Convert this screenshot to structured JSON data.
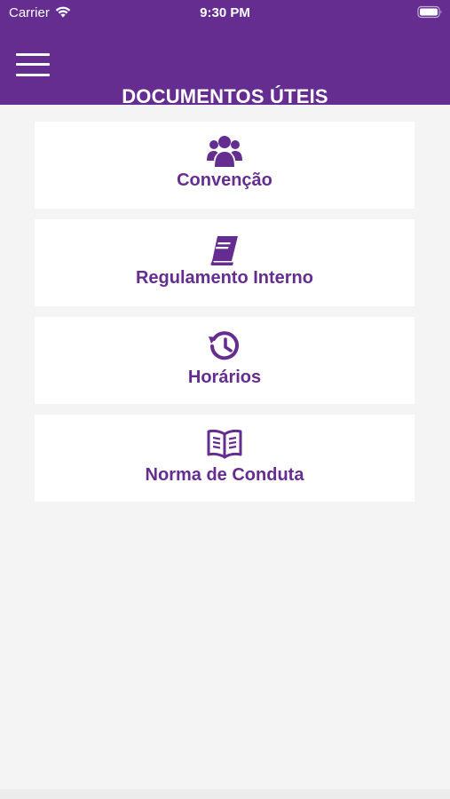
{
  "status_bar": {
    "carrier": "Carrier",
    "time": "9:30 PM"
  },
  "header": {
    "title": "DOCUMENTOS ÚTEIS",
    "menu_icon": "hamburger-menu-icon",
    "background_color": "#662d91"
  },
  "documents": [
    {
      "label": "Convenção",
      "icon": "users-group-icon"
    },
    {
      "label": "Regulamento Interno",
      "icon": "book-icon"
    },
    {
      "label": "Horários",
      "icon": "history-clock-icon"
    },
    {
      "label": "Norma de Conduta",
      "icon": "open-book-icon"
    }
  ],
  "colors": {
    "accent": "#662d91",
    "background": "#f4f4f4",
    "card": "#ffffff"
  }
}
